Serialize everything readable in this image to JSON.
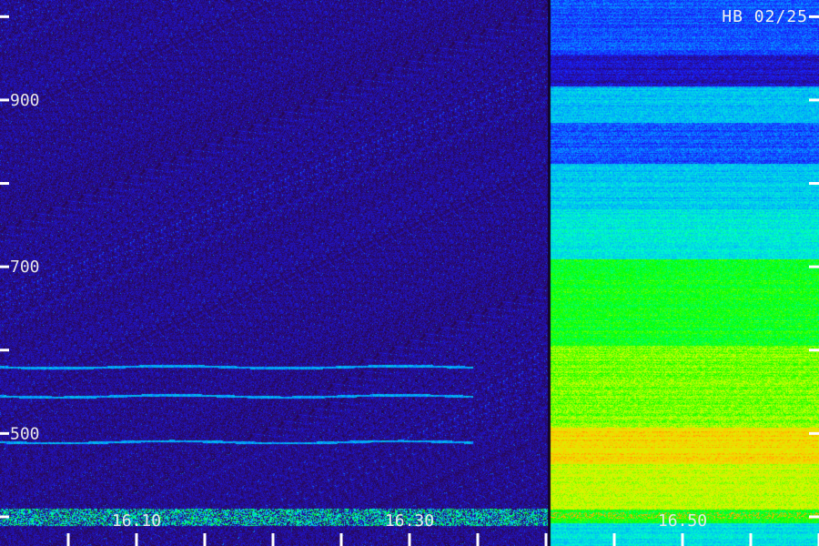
{
  "chart_data": {
    "type": "heatmap",
    "title": "",
    "stamp": "HB 02/25",
    "xlabel": "",
    "ylabel": "",
    "y_tick_labels": [
      "900",
      "700",
      "500"
    ],
    "y_tick_values": [
      900,
      700,
      500
    ],
    "y_minor_ticks": [
      400,
      600,
      800,
      1000
    ],
    "ylim": [
      365,
      1020
    ],
    "x_tick_labels": [
      "16.10",
      "16.30",
      "16.50"
    ],
    "x_tick_values": [
      10,
      30,
      50
    ],
    "x_minor_ticks": [
      5,
      15,
      20,
      25,
      35,
      40,
      45,
      55,
      60
    ],
    "xlim": [
      0,
      60
    ],
    "colormap": [
      "#000000",
      "#2a0a5e",
      "#1a1aff",
      "#00aaff",
      "#00ffcc",
      "#00ff00",
      "#ccff00",
      "#ffcc00",
      "#ff3300"
    ],
    "quiet_until_minute": 40.3,
    "spectral_lines_hz": [
      580,
      545,
      490
    ]
  }
}
